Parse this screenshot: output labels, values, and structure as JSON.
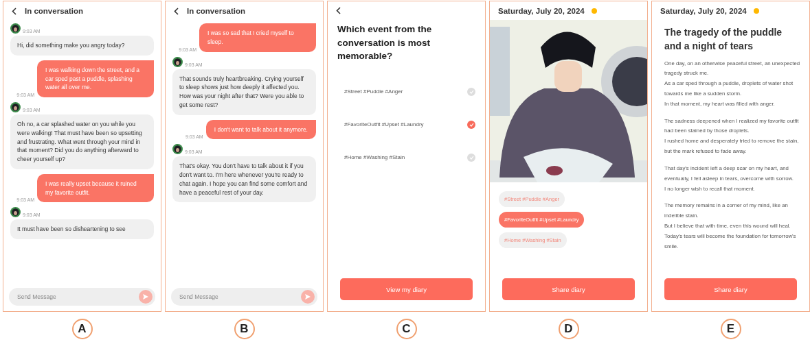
{
  "panels": [
    {
      "kind": "chat",
      "label": "A",
      "title": "In conversation",
      "placeholder": "Send Message",
      "messages": [
        {
          "kind": "bot",
          "time": "9:03 AM",
          "text": "Hi, did something make you angry today?"
        },
        {
          "kind": "user",
          "time": "9:03 AM",
          "text": "I was walking down the street, and a car sped past a puddle, splashing water all over me."
        },
        {
          "kind": "bot",
          "time": "9:03 AM",
          "text": "Oh no, a car splashed water on you while you were walking! That must have been so upsetting and frustrating. What went through your mind in that moment? Did you do anything afterward to cheer yourself up?"
        },
        {
          "kind": "user",
          "time": "9:03 AM",
          "text": "I was really upset because it ruined my favorite outfit."
        },
        {
          "kind": "bot",
          "time": "9:03 AM",
          "text": "It must have been so disheartening to see"
        }
      ]
    },
    {
      "kind": "chat",
      "label": "B",
      "title": "In conversation",
      "placeholder": "Send Message",
      "messages": [
        {
          "kind": "user",
          "time": "9:03 AM",
          "text": "I was so sad that I cried myself to sleep."
        },
        {
          "kind": "bot",
          "time": "9:03 AM",
          "text": "That sounds truly heartbreaking. Crying yourself to sleep shows just how deeply it affected you. How was your night after that? Were you able to get some rest?"
        },
        {
          "kind": "user",
          "time": "9:03 AM",
          "text": "I don't want to talk about it anymore."
        },
        {
          "kind": "bot",
          "time": "9:03 AM",
          "text": "That's okay. You don't have to talk about it if you don't want to. I'm here whenever you're ready to chat again. I hope you can find some comfort and have a peaceful rest of your day."
        }
      ]
    },
    {
      "kind": "choice",
      "label": "C",
      "question": "Which event from the conversation is most memorable?",
      "button": "View my diary",
      "options": [
        {
          "text": "#Street #Puddle #Anger",
          "selected": false
        },
        {
          "text": "#FavoriteOutfit #Upset #Laundry",
          "selected": true
        },
        {
          "text": "#Home #Washing #Stain",
          "selected": false
        }
      ]
    },
    {
      "kind": "diary_image",
      "label": "D",
      "date": "Saturday, July 20, 2024",
      "button": "Share diary",
      "tags": [
        {
          "text": "#Street #Puddle #Anger",
          "selected": false
        },
        {
          "text": "#FavoriteOutfit #Upset #Laundry",
          "selected": true
        },
        {
          "text": "#Home #Washing #Stain",
          "selected": false
        }
      ]
    },
    {
      "kind": "diary_text",
      "label": "E",
      "date": "Saturday, July 20, 2024",
      "title": "The tragedy of the puddle and a night of tears",
      "button": "Share diary",
      "paragraphs": [
        [
          "One day, on an otherwise peaceful street, an unexpected tragedy struck me.",
          "As a car sped through a puddle, droplets of water shot towards me like a sudden storm.",
          "In that moment, my heart was filled with anger."
        ],
        [
          "The sadness deepened when I realized my favorite outfit had been stained by those droplets.",
          "I rushed home and desperately tried to remove the stain, but the mark refused to fade away."
        ],
        [
          "That day's incident left a deep scar on my heart, and eventually, I fell asleep in tears, overcome with sorrow.",
          "I no longer wish to recall that moment."
        ],
        [
          "The memory remains in a corner of my mind, like an indelible stain.",
          "But I believe that with time, even this wound will heal.",
          "Today's tears will become the foundation for tomorrow's smile."
        ]
      ]
    }
  ]
}
